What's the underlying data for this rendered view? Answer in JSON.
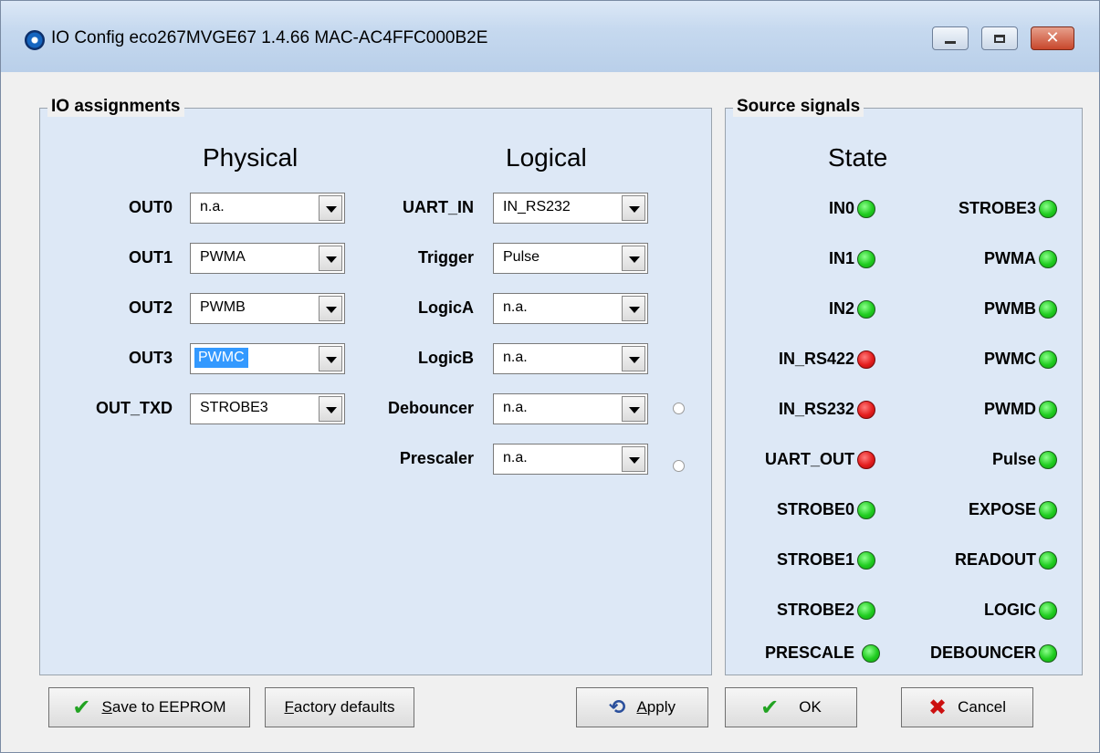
{
  "window": {
    "title": "IO Config eco267MVGE67 1.4.66  MAC-AC4FFC000B2E",
    "icon": "app-eye-icon"
  },
  "io": {
    "group_label": "IO assignments",
    "physical_header": "Physical",
    "logical_header": "Logical",
    "physical": [
      {
        "label": "OUT0",
        "value": "n.a."
      },
      {
        "label": "OUT1",
        "value": "PWMA"
      },
      {
        "label": "OUT2",
        "value": "PWMB"
      },
      {
        "label": "OUT3",
        "value": "PWMC"
      },
      {
        "label": "OUT_TXD",
        "value": "STROBE3"
      }
    ],
    "logical": [
      {
        "label": "UART_IN",
        "value": "IN_RS232"
      },
      {
        "label": "Trigger",
        "value": "Pulse"
      },
      {
        "label": "LogicA",
        "value": "n.a."
      },
      {
        "label": "LogicB",
        "value": "n.a."
      },
      {
        "label": "Debouncer",
        "value": "n.a."
      },
      {
        "label": "Prescaler",
        "value": "n.a."
      }
    ]
  },
  "source": {
    "group_label": "Source signals",
    "state_header": "State",
    "left": [
      {
        "label": "IN0",
        "state": "green"
      },
      {
        "label": "IN1",
        "state": "green"
      },
      {
        "label": "IN2",
        "state": "green"
      },
      {
        "label": "IN_RS422",
        "state": "red"
      },
      {
        "label": "IN_RS232",
        "state": "red"
      },
      {
        "label": "UART_OUT",
        "state": "red"
      },
      {
        "label": "STROBE0",
        "state": "green"
      },
      {
        "label": "STROBE1",
        "state": "green"
      },
      {
        "label": "STROBE2",
        "state": "green"
      },
      {
        "label": "PRESCALE",
        "state": "green"
      }
    ],
    "right": [
      {
        "label": "STROBE3",
        "state": "green"
      },
      {
        "label": "PWMA",
        "state": "green"
      },
      {
        "label": "PWMB",
        "state": "green"
      },
      {
        "label": "PWMC",
        "state": "green"
      },
      {
        "label": "PWMD",
        "state": "green"
      },
      {
        "label": "Pulse",
        "state": "green"
      },
      {
        "label": "EXPOSE",
        "state": "green"
      },
      {
        "label": "READOUT",
        "state": "green"
      },
      {
        "label": "LOGIC",
        "state": "green"
      },
      {
        "label": "DEBOUNCER",
        "state": "green"
      }
    ]
  },
  "buttons": {
    "save_first": "S",
    "save_rest": "ave to EEPROM",
    "factory_first": "F",
    "factory_rest": "actory defaults",
    "apply_first": "A",
    "apply_rest": "pply",
    "ok": "OK",
    "cancel": "Cancel"
  },
  "colors": {
    "led_green": "#1fcc1f",
    "led_red": "#e41d1d",
    "panel_bg": "#dde8f6",
    "selection": "#3399ff"
  }
}
